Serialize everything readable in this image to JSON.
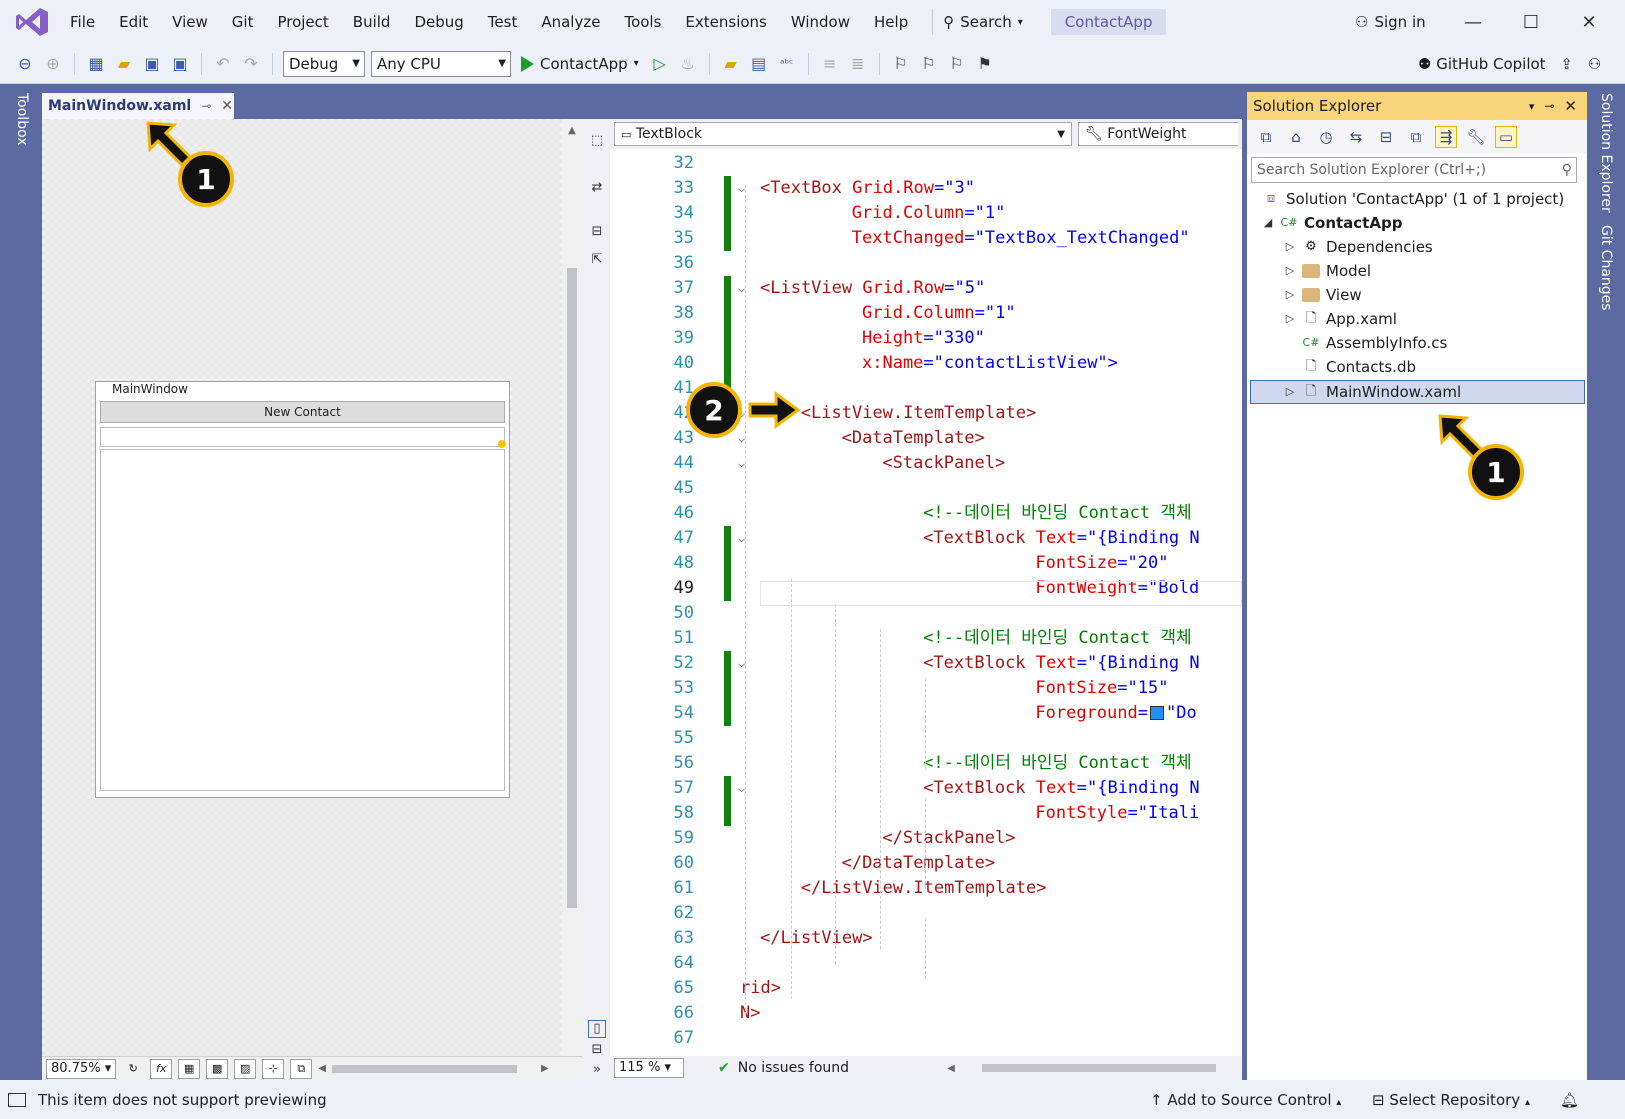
{
  "menu": [
    "File",
    "Edit",
    "View",
    "Git",
    "Project",
    "Build",
    "Debug",
    "Test",
    "Analyze",
    "Tools",
    "Extensions",
    "Window",
    "Help"
  ],
  "search_label": "Search",
  "solution_name": "ContactApp",
  "signin_label": "Sign in",
  "toolbar": {
    "config": "Debug",
    "platform": "Any CPU",
    "run_target": "ContactApp",
    "copilot": "GitHub Copilot"
  },
  "left_panel_label": "Toolbox",
  "doc_tab": "MainWindow.xaml",
  "designer": {
    "window_title": "MainWindow",
    "button_label": "New Contact",
    "zoom": "80.75%"
  },
  "nav": {
    "element": "TextBlock",
    "property": "FontWeight"
  },
  "code_lines": [
    {
      "n": "32",
      "html": ""
    },
    {
      "n": "33",
      "fold": true,
      "chg": true,
      "parts": [
        [
          "tag",
          "<TextBox "
        ],
        [
          "att",
          "Grid.Row"
        ],
        [
          "bracket",
          "="
        ],
        [
          "val",
          "\"3\""
        ]
      ],
      "indent": 0
    },
    {
      "n": "34",
      "chg": true,
      "parts": [
        [
          "att",
          "Grid.Column"
        ],
        [
          "bracket",
          "="
        ],
        [
          "val",
          "\"1\""
        ]
      ],
      "indent": 9
    },
    {
      "n": "35",
      "chg": true,
      "parts": [
        [
          "att",
          "TextChanged"
        ],
        [
          "bracket",
          "="
        ],
        [
          "val",
          "\"TextBox_TextChanged\""
        ]
      ],
      "indent": 9
    },
    {
      "n": "36",
      "parts": []
    },
    {
      "n": "37",
      "fold": true,
      "chg": true,
      "parts": [
        [
          "tag",
          "<ListView "
        ],
        [
          "att",
          "Grid.Row"
        ],
        [
          "bracket",
          "="
        ],
        [
          "val",
          "\"5\""
        ]
      ],
      "indent": 0
    },
    {
      "n": "38",
      "chg": true,
      "parts": [
        [
          "att",
          "Grid.Column"
        ],
        [
          "bracket",
          "="
        ],
        [
          "val",
          "\"1\""
        ]
      ],
      "indent": 10
    },
    {
      "n": "39",
      "chg": true,
      "parts": [
        [
          "att",
          "Height"
        ],
        [
          "bracket",
          "="
        ],
        [
          "val",
          "\"330\""
        ]
      ],
      "indent": 10
    },
    {
      "n": "40",
      "chg": true,
      "parts": [
        [
          "att",
          "x:Name"
        ],
        [
          "bracket",
          "="
        ],
        [
          "val",
          "\"contactListView\""
        ],
        [
          "val",
          ">"
        ]
      ],
      "indent": 10
    },
    {
      "n": "41",
      "chg": true,
      "parts": []
    },
    {
      "n": "42",
      "fold": true,
      "parts": [
        [
          "tag",
          "<ListView.ItemTemplate>"
        ]
      ],
      "indent": 4
    },
    {
      "n": "43",
      "fold": true,
      "parts": [
        [
          "tag",
          "<DataTemplate>"
        ]
      ],
      "indent": 8
    },
    {
      "n": "44",
      "fold": true,
      "parts": [
        [
          "tag",
          "<StackPanel>"
        ]
      ],
      "indent": 12
    },
    {
      "n": "45",
      "parts": []
    },
    {
      "n": "46",
      "parts": [
        [
          "cmt",
          "<!--데이터 바인딩 Contact 객체"
        ]
      ],
      "indent": 16
    },
    {
      "n": "47",
      "fold": true,
      "chg": true,
      "parts": [
        [
          "tag",
          "<TextBlock "
        ],
        [
          "att",
          "Text"
        ],
        [
          "bracket",
          "="
        ],
        [
          "val",
          "\"{Binding N"
        ]
      ],
      "indent": 16
    },
    {
      "n": "48",
      "chg": true,
      "parts": [
        [
          "att",
          "FontSize"
        ],
        [
          "bracket",
          "="
        ],
        [
          "val",
          "\"20\""
        ]
      ],
      "indent": 27
    },
    {
      "n": "49",
      "cur": true,
      "chg": true,
      "parts": [
        [
          "att",
          "FontWeight"
        ],
        [
          "bracket",
          "="
        ],
        [
          "val",
          "\"Bold"
        ]
      ],
      "indent": 27
    },
    {
      "n": "50",
      "parts": []
    },
    {
      "n": "51",
      "parts": [
        [
          "cmt",
          "<!--데이터 바인딩 Contact 객체"
        ]
      ],
      "indent": 16
    },
    {
      "n": "52",
      "fold": true,
      "chg": true,
      "parts": [
        [
          "tag",
          "<TextBlock "
        ],
        [
          "att",
          "Text"
        ],
        [
          "bracket",
          "="
        ],
        [
          "val",
          "\"{Binding N"
        ]
      ],
      "indent": 16
    },
    {
      "n": "53",
      "chg": true,
      "parts": [
        [
          "att",
          "FontSize"
        ],
        [
          "bracket",
          "="
        ],
        [
          "val",
          "\"15\""
        ]
      ],
      "indent": 27
    },
    {
      "n": "54",
      "chg": true,
      "parts": [
        [
          "att",
          "Foreground"
        ],
        [
          "bracket",
          "="
        ],
        [
          "swatch",
          ""
        ],
        [
          "val",
          "\"Do"
        ]
      ],
      "indent": 27
    },
    {
      "n": "55",
      "parts": []
    },
    {
      "n": "56",
      "parts": [
        [
          "cmt",
          "<!--데이터 바인딩 Contact 객체"
        ]
      ],
      "indent": 16
    },
    {
      "n": "57",
      "fold": true,
      "chg": true,
      "parts": [
        [
          "tag",
          "<TextBlock "
        ],
        [
          "att",
          "Text"
        ],
        [
          "bracket",
          "="
        ],
        [
          "val",
          "\"{Binding N"
        ]
      ],
      "indent": 16
    },
    {
      "n": "58",
      "chg": true,
      "parts": [
        [
          "att",
          "FontStyle"
        ],
        [
          "bracket",
          "="
        ],
        [
          "val",
          "\"Itali"
        ]
      ],
      "indent": 27
    },
    {
      "n": "59",
      "parts": [
        [
          "tag",
          "</StackPanel>"
        ]
      ],
      "indent": 12
    },
    {
      "n": "60",
      "parts": [
        [
          "tag",
          "</DataTemplate>"
        ]
      ],
      "indent": 8
    },
    {
      "n": "61",
      "parts": [
        [
          "tag",
          "</ListView.ItemTemplate>"
        ]
      ],
      "indent": 4
    },
    {
      "n": "62",
      "parts": []
    },
    {
      "n": "63",
      "parts": [
        [
          "tag",
          "</ListView>"
        ]
      ],
      "indent": 0
    },
    {
      "n": "64",
      "parts": []
    },
    {
      "n": "65",
      "parts": [
        [
          "tag",
          "rid>"
        ]
      ],
      "indent": -1
    },
    {
      "n": "66",
      "parts": [
        [
          "tag",
          "N>"
        ]
      ],
      "indent": -1
    },
    {
      "n": "67",
      "parts": []
    }
  ],
  "editor_status": {
    "zoom": "115 %",
    "issues": "No issues found"
  },
  "solution_explorer": {
    "title": "Solution Explorer",
    "search_placeholder": "Search Solution Explorer (Ctrl+;)",
    "solution": "Solution 'ContactApp' (1 of 1 project)",
    "project": "ContactApp",
    "items": [
      "Dependencies",
      "Model",
      "View",
      "App.xaml",
      "AssemblyInfo.cs",
      "Contacts.db",
      "MainWindow.xaml"
    ]
  },
  "right_tabs": [
    "Solution Explorer",
    "Git Changes"
  ],
  "statusbar": {
    "message": "This item does not support previewing",
    "source_control": "Add to Source Control",
    "repo": "Select Repository"
  },
  "annotations": [
    "1",
    "2",
    "1"
  ],
  "colors": {
    "accent": "#5b6aa0",
    "highlight": "#f5b400",
    "change_bar": "#108010"
  }
}
